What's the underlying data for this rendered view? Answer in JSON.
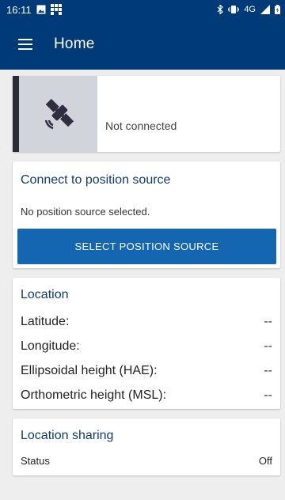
{
  "status_bar": {
    "time": "16:11",
    "network": "4G",
    "icons": [
      "image-icon",
      "app-grid-icon",
      "bluetooth-icon",
      "vibrate-icon",
      "signal-icon",
      "battery-icon"
    ]
  },
  "app_bar": {
    "title": "Home",
    "menu_icon": "hamburger-menu-icon",
    "color": "#003a78"
  },
  "connection_status": {
    "text": "Not connected",
    "icon": "satellite-icon"
  },
  "connect_card": {
    "title": "Connect to position source",
    "message": "No position source selected.",
    "button_label": "SELECT POSITION SOURCE",
    "button_color": "#1466b0"
  },
  "location_card": {
    "title": "Location",
    "rows": [
      {
        "label": "Latitude:",
        "value": "--"
      },
      {
        "label": "Longitude:",
        "value": "--"
      },
      {
        "label": "Ellipsoidal height (HAE):",
        "value": "--"
      },
      {
        "label": "Orthometric height (MSL):",
        "value": "--"
      }
    ]
  },
  "sharing_card": {
    "title": "Location sharing",
    "status_label": "Status",
    "status_value": "Off"
  }
}
